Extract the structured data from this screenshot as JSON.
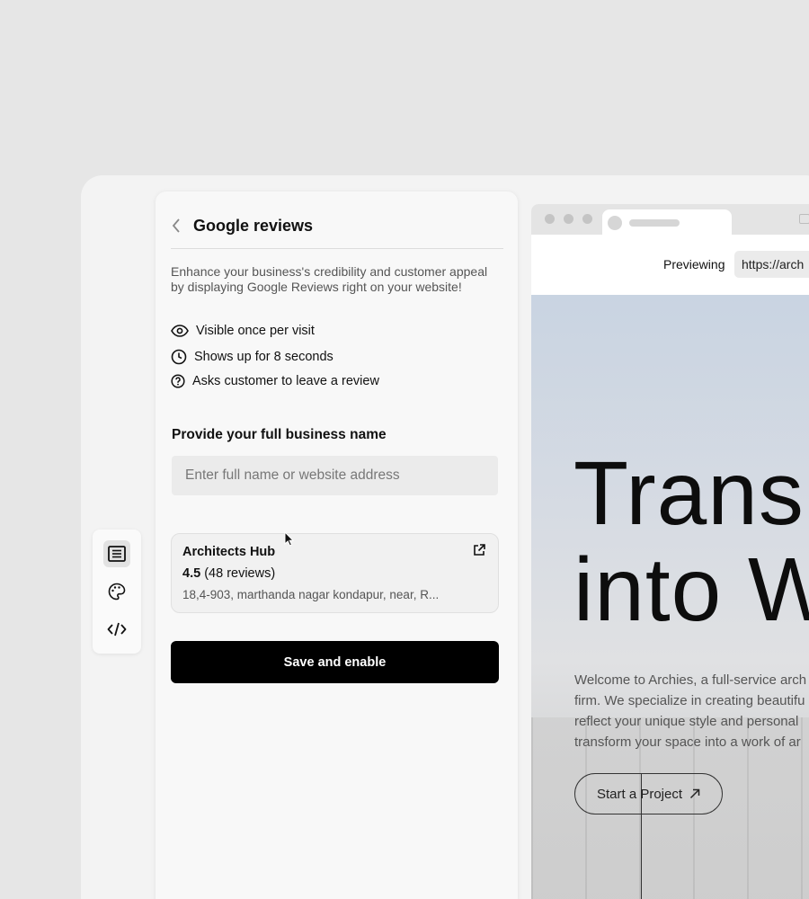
{
  "panel": {
    "title": "Google reviews",
    "description": "Enhance your business's credibility and customer appeal by displaying Google Reviews right on your website!",
    "features": [
      {
        "icon": "eye-icon",
        "label": "Visible once per visit"
      },
      {
        "icon": "clock-icon",
        "label": "Shows up for 8 seconds"
      },
      {
        "icon": "question-circle-icon",
        "label": "Asks customer to leave a review"
      }
    ],
    "business_label": "Provide your full business name",
    "business_placeholder": "Enter full name or website address",
    "result": {
      "name": "Architects Hub",
      "rating": "4.5",
      "reviews": "(48 reviews)",
      "address": "18,4-903, marthanda nagar kondapur, near, R..."
    },
    "save_label": "Save and enable"
  },
  "toolbar": {
    "items": [
      "content-icon",
      "palette-icon",
      "code-icon"
    ]
  },
  "preview": {
    "label": "Previewing",
    "url": "https://arch",
    "headline_line1": "Trans",
    "headline_line2": "into W",
    "lead_lines": [
      "Welcome to Archies, a full-service arch",
      "firm. We specialize in creating beautifu",
      "reflect your unique style and personal",
      "transform your space into a work of ar"
    ],
    "cta_label": "Start a Project"
  },
  "colors": {
    "primary_button": "#000000",
    "background": "#e6e6e6"
  }
}
